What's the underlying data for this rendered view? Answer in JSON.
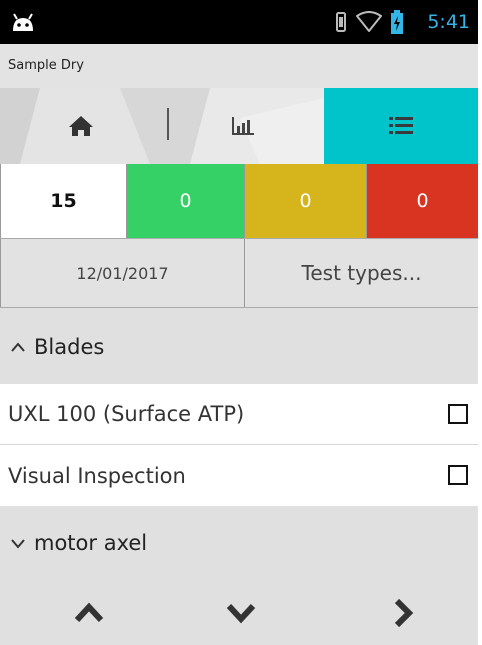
{
  "status_bar": {
    "time": "5:41",
    "icons": [
      "android-icon",
      "vibrate-icon",
      "wifi-icon",
      "battery-charging-icon"
    ]
  },
  "app": {
    "title": "Sample Dry"
  },
  "tabs": [
    {
      "name": "home",
      "icon": "home-icon",
      "active": false
    },
    {
      "name": "chart",
      "icon": "bar-chart-icon",
      "active": false
    },
    {
      "name": "list",
      "icon": "list-icon",
      "active": true
    }
  ],
  "counters": {
    "total": "15",
    "pass": "0",
    "caution": "0",
    "fail": "0"
  },
  "controls": {
    "date": "12/01/2017",
    "test_types": "Test types..."
  },
  "groups": [
    {
      "name": "Blades",
      "expanded": true,
      "items": [
        {
          "label": "UXL 100 (Surface ATP)",
          "checked": false
        },
        {
          "label": "Visual Inspection",
          "checked": false
        }
      ]
    },
    {
      "name": "motor axel",
      "expanded": false
    }
  ],
  "colors": {
    "accent": "#00c4c9",
    "pass": "#35d066",
    "caution": "#d5b41c",
    "fail": "#d93322",
    "time": "#33b5e5"
  },
  "nav": {
    "icons": [
      "chevron-up-icon",
      "chevron-down-icon",
      "chevron-right-icon"
    ]
  }
}
